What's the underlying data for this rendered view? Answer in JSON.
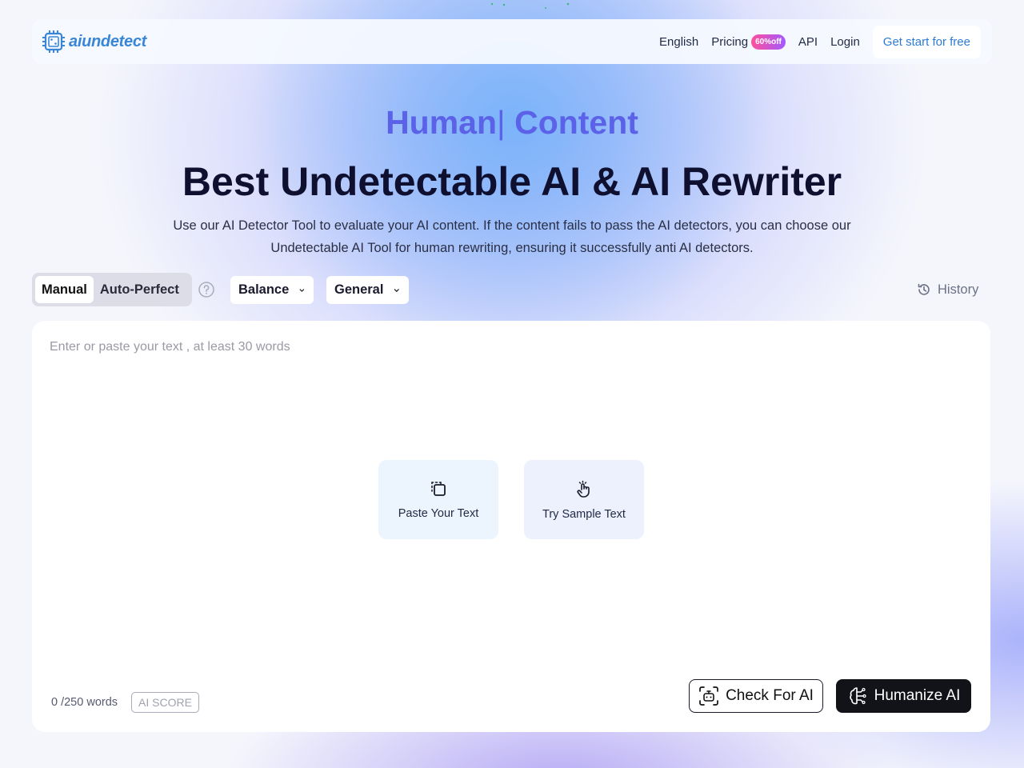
{
  "brand": {
    "name": "aiundetect",
    "accent": "#3a86d6"
  },
  "nav": {
    "language": "English",
    "pricing": "Pricing",
    "pricing_badge": "60%off",
    "api": "API",
    "login": "Login",
    "cta": "Get start for free"
  },
  "hero": {
    "typed_text": "Human",
    "typed_cursor": "|",
    "typed_word": " Content",
    "title": "Best Undetectable AI & AI Rewriter",
    "description": "Use our AI Detector Tool to evaluate your AI content. If the content fails to pass the AI detectors, you can choose our Undetectable AI Tool for human rewriting, ensuring it successfully anti AI detectors."
  },
  "toolbar": {
    "modes": [
      "Manual",
      "Auto-Perfect"
    ],
    "active_mode": "Manual",
    "strength_select": "Balance",
    "purpose_select": "General",
    "history": "History"
  },
  "editor": {
    "placeholder": "Enter or paste your text , at least 30 words",
    "paste_label": "Paste Your Text",
    "sample_label": "Try Sample Text",
    "word_count": "0 /250 words",
    "ai_score": "AI SCORE",
    "check_button": "Check For AI",
    "humanize_button": "Humanize AI"
  },
  "colors": {
    "typed_heading": "#5b62e8",
    "primary_dark": "#111318",
    "pricing_badge_gradient": [
      "#ff4f9a",
      "#a259ff"
    ]
  }
}
